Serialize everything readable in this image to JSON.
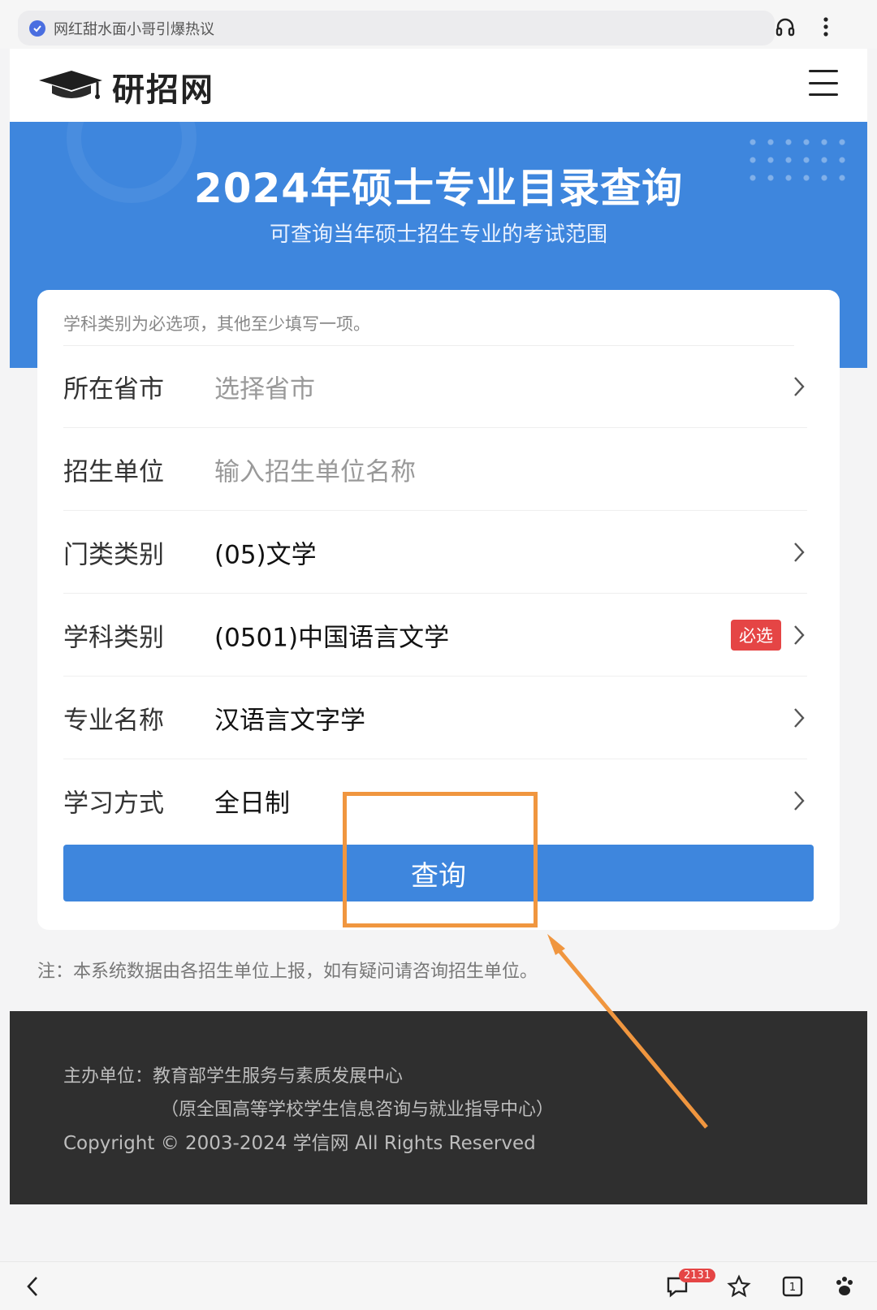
{
  "browser": {
    "address_text": "网红甜水面小哥引爆热议",
    "bottom_count": "2131",
    "tab_count": "1"
  },
  "site": {
    "logo_text": "研招网"
  },
  "banner": {
    "title": "2024年硕士专业目录查询",
    "subtitle": "可查询当年硕士招生专业的考试范围"
  },
  "form": {
    "hint": "学科类别为必选项，其他至少填写一项。",
    "rows": [
      {
        "label": "所在省市",
        "value": "选择省市",
        "placeholder": true
      },
      {
        "label": "招生单位",
        "value": "输入招生单位名称",
        "placeholder": true
      },
      {
        "label": "门类类别",
        "value": "(05)文学",
        "placeholder": false
      },
      {
        "label": "学科类别",
        "value": "(0501)中国语言文学",
        "placeholder": false,
        "badge": "必选"
      },
      {
        "label": "专业名称",
        "value": "汉语言文字学",
        "placeholder": false
      },
      {
        "label": "学习方式",
        "value": "全日制",
        "placeholder": false
      }
    ],
    "submit_label": "查询"
  },
  "note": "注：本系统数据由各招生单位上报，如有疑问请咨询招生单位。",
  "footer": {
    "line1": "主办单位：教育部学生服务与素质发展中心",
    "line2": "（原全国高等学校学生信息咨询与就业指导中心）",
    "copyright": "Copyright © 2003-2024 学信网 All Rights Reserved"
  },
  "colors": {
    "primary_blue": "#3e86dd",
    "badge_red": "#e54545",
    "annotation_orange": "#f0963f",
    "footer_bg": "#2f2f2f"
  }
}
